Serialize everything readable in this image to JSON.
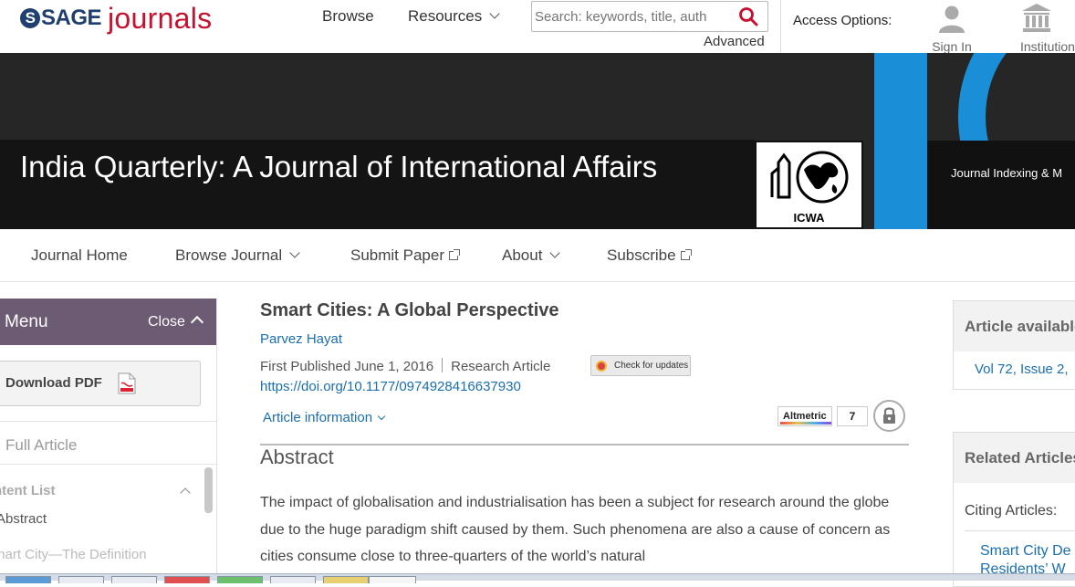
{
  "header": {
    "logo_sage": "SAGE",
    "logo_journals": "journals",
    "browse": "Browse",
    "resources": "Resources",
    "search_placeholder": "Search: keywords, title, auth",
    "advanced": "Advanced",
    "access_options": "Access Options:",
    "sign_in": "Sign In",
    "institution": "Institution"
  },
  "banner": {
    "journal_title": "India Quarterly: A Journal of International Affairs",
    "icwa_label": "ICWA",
    "indexing": "Journal Indexing & M"
  },
  "journal_nav": {
    "items": [
      {
        "label": "Journal Home"
      },
      {
        "label": "Browse Journal"
      },
      {
        "label": "Submit Paper"
      },
      {
        "label": "About"
      },
      {
        "label": "Subscribe"
      }
    ]
  },
  "sidebar": {
    "menu_title": "Menu",
    "close": "Close",
    "download_pdf": "Download PDF",
    "full_article": "Full Article",
    "content_list": "Content List",
    "toc_items": [
      "Abstract",
      "Smart City—The Definition"
    ]
  },
  "article": {
    "title": "Smart Cities: A Global Perspective",
    "author": "Parvez Hayat",
    "first_published": "First Published June 1, 2016",
    "type": "Research Article",
    "check_updates": "Check for updates",
    "doi": "https://doi.org/10.1177/0974928416637930",
    "article_information": "Article information",
    "altmetric_label": "Altmetric",
    "altmetric_count": "7",
    "abstract_heading": "Abstract",
    "abstract_text": "The impact of globalisation and industrialisation has been a subject for research around the globe due to the huge paradigm shift caused by them. Such phenomena are also a cause of concern as cities consume close to three-quarters of the world’s natural"
  },
  "right": {
    "availability_heading": "Article available in:",
    "issue_link": "Vol 72, Issue 2,",
    "related_heading": "Related Articles",
    "citing": "Citing Articles:",
    "related_link": "Smart City De Residents’ W"
  },
  "colors": {
    "sage_blue": "#1f3f6e",
    "journals_red": "#c8102e",
    "menu_purple": "#6c5b72",
    "link_blue": "#1a6fb0",
    "accent_blue": "#1a8fd8"
  }
}
